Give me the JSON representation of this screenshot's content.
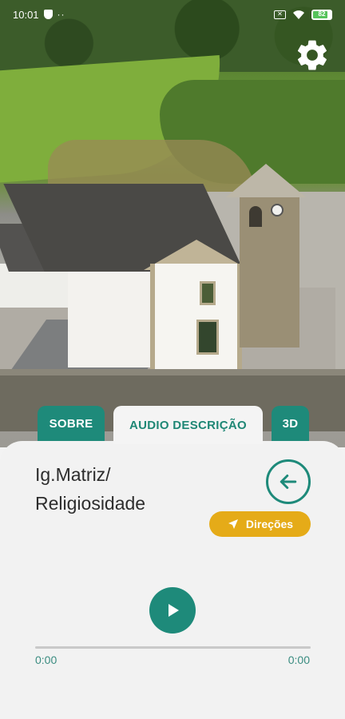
{
  "status_bar": {
    "time": "10:01",
    "battery": "82",
    "battery_level": 0.82,
    "icons": [
      "shield-icon",
      "more-dots-icon",
      "sim-x-icon",
      "wifi-icon",
      "battery-icon"
    ]
  },
  "settings": {
    "icon": "gear-icon"
  },
  "tabs": [
    {
      "label": "SOBRE",
      "active": false
    },
    {
      "label": "AUDIO DESCRIÇÃO",
      "active": true
    },
    {
      "label": "3D",
      "active": false
    }
  ],
  "point": {
    "title_line1": "Ig.Matriz/",
    "title_line2": "Religiosidade"
  },
  "directions": {
    "label": "Direções",
    "icon": "navigation-arrow-icon"
  },
  "back": {
    "icon": "arrow-left-icon"
  },
  "player": {
    "play_icon": "play-icon",
    "current_time": "0:00",
    "total_time": "0:00",
    "progress": 0
  },
  "colors": {
    "accent": "#1e8a7a",
    "directions": "#e5ab18",
    "sheet": "#f2f2f2"
  }
}
